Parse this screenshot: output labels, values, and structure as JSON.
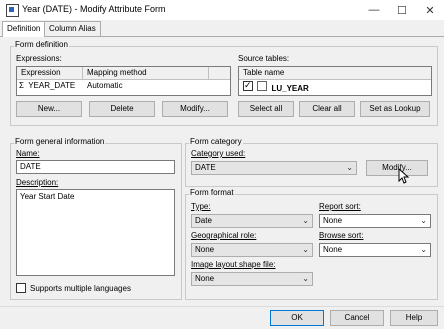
{
  "window": {
    "title": "Year (DATE) - Modify Attribute Form",
    "minimize": "—",
    "maximize": "☐",
    "close": "✕"
  },
  "tabs": [
    {
      "label": "Definition"
    },
    {
      "label": "Column Alias"
    }
  ],
  "form_definition": {
    "group_label": "Form definition",
    "expressions_label": "Expressions:",
    "expr_headers": [
      "Expression",
      "Mapping method"
    ],
    "expr_rows": [
      {
        "icon": "Σ",
        "expression": "YEAR_DATE",
        "mapping": "Automatic"
      }
    ],
    "source_tables_label": "Source tables:",
    "source_header": "Table name",
    "source_rows": [
      {
        "checked": true,
        "name": "LU_YEAR"
      }
    ],
    "buttons": {
      "new": "New...",
      "delete": "Delete",
      "modify": "Modify...",
      "select_all": "Select all",
      "clear_all": "Clear all",
      "set_as_lookup": "Set as Lookup"
    }
  },
  "general_info": {
    "group_label": "Form general information",
    "name_label": "Name:",
    "name_value": "DATE",
    "description_label": "Description:",
    "description_value": "Year Start Date",
    "supports_multiple_languages": "Supports multiple languages"
  },
  "form_category": {
    "group_label": "Form category",
    "category_used_label": "Category used:",
    "category_used_value": "DATE",
    "modify_button": "Modify..."
  },
  "form_format": {
    "group_label": "Form format",
    "type_label": "Type:",
    "type_value": "Date",
    "report_sort_label": "Report sort:",
    "report_sort_value": "None",
    "geo_role_label": "Geographical role:",
    "geo_role_value": "None",
    "browse_sort_label": "Browse sort:",
    "browse_sort_value": "None",
    "image_layout_label": "Image layout shape file:",
    "image_layout_value": "None"
  },
  "footer": {
    "ok": "OK",
    "cancel": "Cancel",
    "help": "Help"
  }
}
